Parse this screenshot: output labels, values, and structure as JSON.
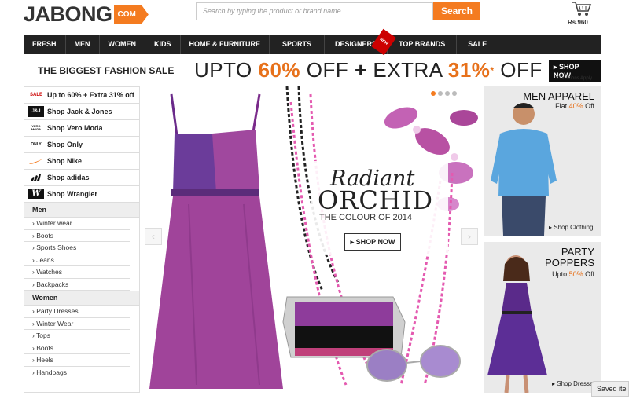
{
  "header": {
    "logo_text": "JABONG",
    "logo_suffix": "COM",
    "search_placeholder": "Search by typing the product or brand name...",
    "search_button": "Search",
    "cart_price": "Rs.960"
  },
  "nav": {
    "items": [
      "FRESH",
      "MEN",
      "WOMEN",
      "KIDS",
      "HOME & FURNITURE",
      "SPORTS",
      "DESIGNERS",
      "TOP BRANDS",
      "SALE"
    ],
    "new_badge": "NEW"
  },
  "banner": {
    "left": "THE BIGGEST FASHION SALE",
    "part1": "UPTO ",
    "pct1": "60%",
    "part2": " OFF ",
    "plus": "+",
    "part3": " EXTRA ",
    "pct2": "31%",
    "star": "*",
    "part4": " OFF",
    "shop_now": "SHOP NOW",
    "conditions": "*Conditions Apply"
  },
  "sidebar": {
    "promos": [
      {
        "logo": "SALE",
        "label": "Up to 60% + Extra 31% off"
      },
      {
        "logo": "J&J",
        "label": "Shop Jack & Jones"
      },
      {
        "logo": "VERO MODA",
        "label": "Shop Vero Moda"
      },
      {
        "logo": "ONLY",
        "label": "Shop Only"
      },
      {
        "logo": "nike-swoosh",
        "label": "Shop Nike"
      },
      {
        "logo": "adidas",
        "label": "Shop adidas"
      },
      {
        "logo": "W",
        "label": "Shop Wrangler"
      }
    ],
    "men_heading": "Men",
    "men_links": [
      "Winter wear",
      "Boots",
      "Sports Shoes",
      "Jeans",
      "Watches",
      "Backpacks"
    ],
    "women_heading": "Women",
    "women_links": [
      "Party Dresses",
      "Winter Wear",
      "Tops",
      "Boots",
      "Heels",
      "Handbags"
    ]
  },
  "hero": {
    "title1": "Radiant",
    "title2": "ORCHID",
    "subtitle": "THE COLOUR OF 2014",
    "button": "SHOP NOW",
    "slide_count": 4,
    "active_slide": 1
  },
  "cards": {
    "men": {
      "title": "MEN APPAREL",
      "sub_prefix": "Flat ",
      "sub_pct": "40%",
      "sub_suffix": " Off",
      "link": "Shop Clothing"
    },
    "party": {
      "title1": "PARTY",
      "title2": "POPPERS",
      "sub_prefix": "Upto ",
      "sub_pct": "50%",
      "sub_suffix": " Off",
      "link": "Shop Dresse"
    }
  },
  "saved_items": "Saved ite",
  "colors": {
    "accent": "#f47b20",
    "nav_bg": "#222222",
    "orchid": "#b0429a"
  }
}
